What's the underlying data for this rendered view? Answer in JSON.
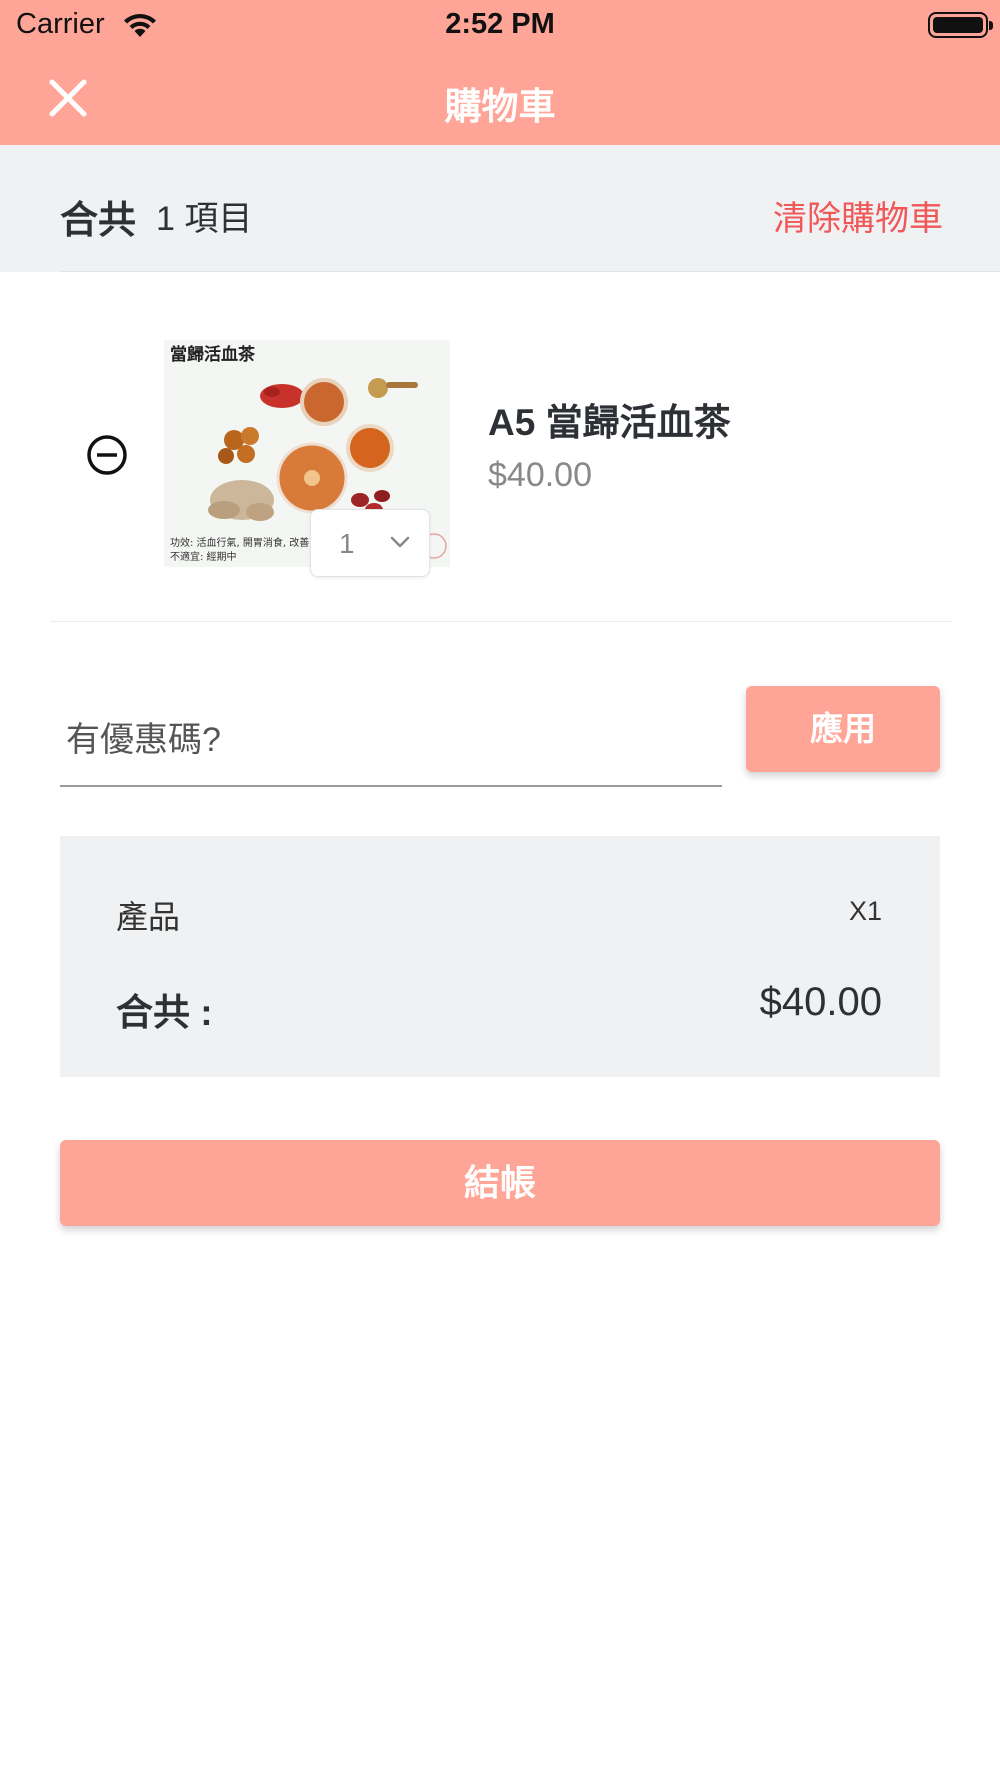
{
  "status_bar": {
    "carrier": "Carrier",
    "time": "2:52 PM"
  },
  "nav": {
    "title": "購物車",
    "close_icon": "close-icon"
  },
  "summary": {
    "total_label": "合共",
    "count_text": "1 項目",
    "clear_label": "清除購物車"
  },
  "cart_items": [
    {
      "name": "A5 當歸活血茶",
      "price": "$40.00",
      "quantity": "1",
      "image_title": "當歸活血茶",
      "image_caption_1": "功效: 活血行氣, 開胃消食, 改善",
      "image_caption_2": "不適宜: 經期中"
    }
  ],
  "coupon": {
    "placeholder": "有優惠碼?",
    "value": "",
    "apply_label": "應用"
  },
  "totals": {
    "product_label": "產品",
    "product_qty": "X1",
    "sum_label": "合共 :",
    "sum_value": "$40.00"
  },
  "checkout": {
    "label": "結帳"
  },
  "colors": {
    "accent": "#ffa597",
    "danger_text": "#f25757",
    "panel_bg": "#eff1f3"
  }
}
